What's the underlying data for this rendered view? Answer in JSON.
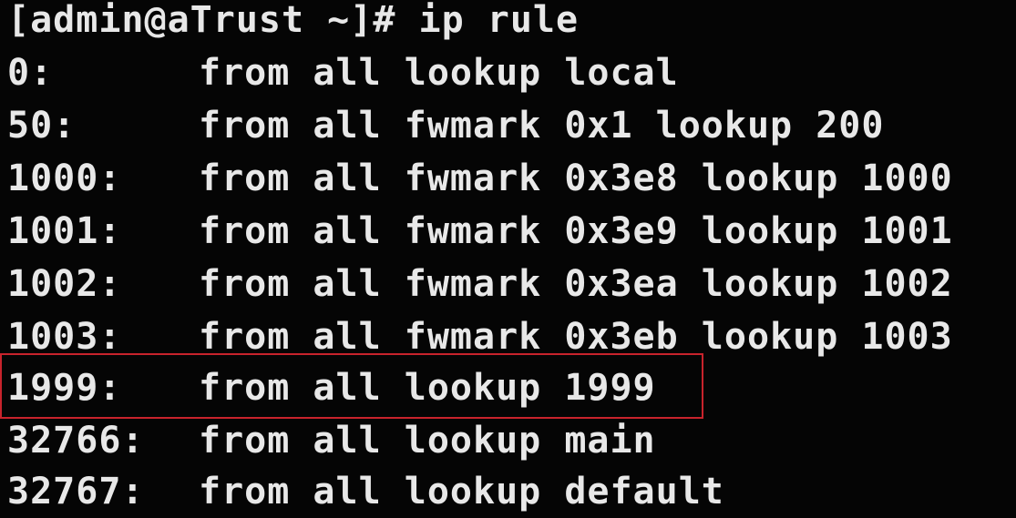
{
  "terminal": {
    "prompt": "[admin@aTrust ~]# ",
    "command": "ip rule",
    "rules": [
      {
        "priority": "0:",
        "rule": "from all lookup local"
      },
      {
        "priority": "50:",
        "rule": "from all fwmark 0x1 lookup 200"
      },
      {
        "priority": "1000:",
        "rule": "from all fwmark 0x3e8 lookup 1000"
      },
      {
        "priority": "1001:",
        "rule": "from all fwmark 0x3e9 lookup 1001"
      },
      {
        "priority": "1002:",
        "rule": "from all fwmark 0x3ea lookup 1002"
      },
      {
        "priority": "1003:",
        "rule": "from all fwmark 0x3eb lookup 1003"
      },
      {
        "priority": "1999:",
        "rule": "from all lookup 1999"
      },
      {
        "priority": "32766:",
        "rule": "from all lookup main"
      },
      {
        "priority": "32767:",
        "rule": "from all lookup default"
      }
    ],
    "highlight_color": "#c8232c",
    "text_color": "#e8e8e8",
    "background_color": "#050505"
  }
}
